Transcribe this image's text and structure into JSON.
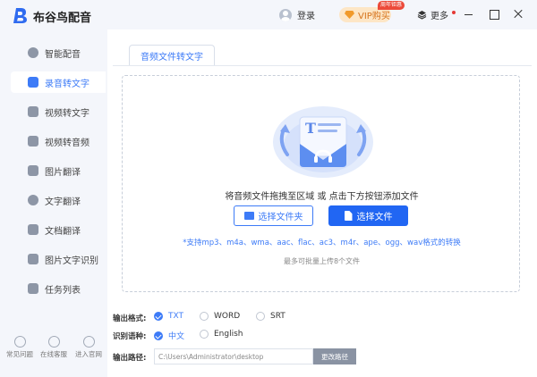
{
  "app": {
    "title": "布谷鸟配音"
  },
  "header": {
    "login_label": "登录",
    "vip_label": "VIP购买",
    "vip_badge": "周年钜惠",
    "more_label": "更多"
  },
  "sidebar": {
    "items": [
      {
        "label": "智能配音",
        "icon": "smart-dub-icon",
        "active": false
      },
      {
        "label": "录音转文字",
        "icon": "audio-to-text-icon",
        "active": true
      },
      {
        "label": "视频转文字",
        "icon": "video-to-text-icon",
        "active": false
      },
      {
        "label": "视频转音频",
        "icon": "video-to-audio-icon",
        "active": false
      },
      {
        "label": "图片翻译",
        "icon": "image-translate-icon",
        "active": false
      },
      {
        "label": "文字翻译",
        "icon": "text-translate-icon",
        "active": false
      },
      {
        "label": "文档翻译",
        "icon": "doc-translate-icon",
        "active": false
      },
      {
        "label": "图片文字识别",
        "icon": "ocr-icon",
        "active": false
      },
      {
        "label": "任务列表",
        "icon": "task-list-icon",
        "active": false
      }
    ],
    "footer": [
      {
        "label": "常见问题",
        "icon": "faq-icon"
      },
      {
        "label": "在线客服",
        "icon": "support-icon"
      },
      {
        "label": "进入官网",
        "icon": "website-icon"
      }
    ]
  },
  "main": {
    "tab_label": "音频文件转文字",
    "drop_hint": "将音频文件拖拽至区域 或 点击下方按钮添加文件",
    "btn_select_folder": "选择文件夹",
    "btn_select_file": "选择文件",
    "supported_formats": "*支持mp3、m4a、wma、aac、flac、ac3、m4r、ape、ogg、wav格式的转换",
    "batch_limit": "最多可批量上传8个文件",
    "output_format_label": "输出格式:",
    "output_formats": [
      "TXT",
      "WORD",
      "SRT"
    ],
    "output_format_selected": "TXT",
    "language_label": "识别语种:",
    "languages": [
      "中文",
      "English"
    ],
    "language_selected": "中文",
    "output_path_label": "输出路径:",
    "output_path_value": "C:\\Users\\Administrator\\desktop",
    "change_path_label": "更改路径"
  },
  "colors": {
    "accent": "#3d7bf7",
    "primary_button": "#2166f3",
    "vip": "#d6731b"
  }
}
